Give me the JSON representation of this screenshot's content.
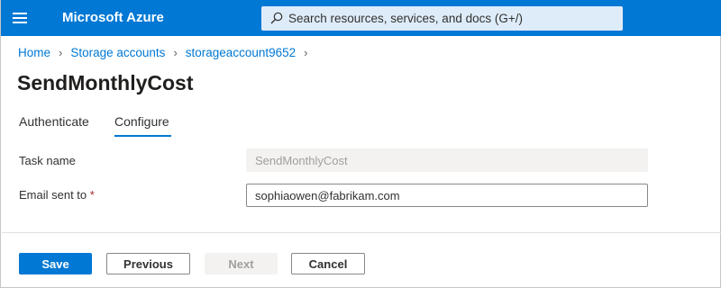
{
  "colors": {
    "accent": "#0078d4",
    "search_bg": "#deecf9",
    "required": "#a4262c",
    "disabled_bg": "#f3f2f1"
  },
  "topbar": {
    "menu_icon": "hamburger-icon",
    "brand": "Microsoft Azure",
    "search_icon": "search-icon",
    "search_placeholder": "Search resources, services, and docs (G+/)"
  },
  "breadcrumb": {
    "items": [
      "Home",
      "Storage accounts",
      "storageaccount9652"
    ],
    "separator_icon": "chevron-right-icon"
  },
  "page": {
    "title": "SendMonthlyCost"
  },
  "tabs": [
    {
      "label": "Authenticate",
      "active": false
    },
    {
      "label": "Configure",
      "active": true
    }
  ],
  "form": {
    "task_name": {
      "label": "Task name",
      "value": "SendMonthlyCost",
      "disabled": true
    },
    "email": {
      "label": "Email sent to",
      "required_marker": "*",
      "value": "sophiaowen@fabrikam.com"
    }
  },
  "footer": {
    "save": "Save",
    "previous": "Previous",
    "next": "Next",
    "cancel": "Cancel"
  }
}
